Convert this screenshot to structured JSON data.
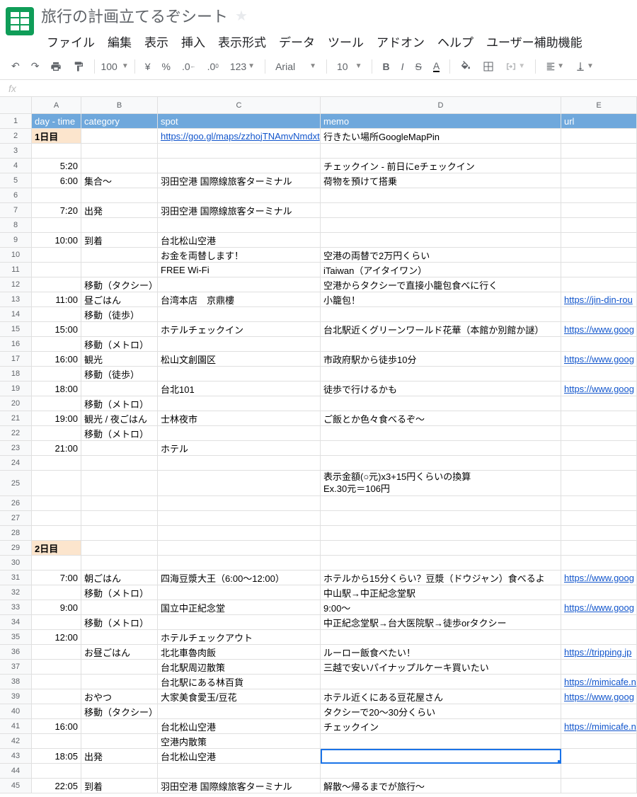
{
  "doc": {
    "title": "旅行の計画立てるぞシート"
  },
  "menu": [
    "ファイル",
    "編集",
    "表示",
    "挿入",
    "表示形式",
    "データ",
    "ツール",
    "アドオン",
    "ヘルプ",
    "ユーザー補助機能"
  ],
  "toolbar": {
    "zoom": "100",
    "currency": "¥",
    "percent": "%",
    "dec_dec": ".0",
    "dec_inc": ".00",
    "numfmt": "123",
    "font": "Arial",
    "size": "10"
  },
  "cols": [
    "A",
    "B",
    "C",
    "D",
    "E"
  ],
  "headers": {
    "A": "day - time",
    "B": "category",
    "C": "spot",
    "D": "memo",
    "E": "url"
  },
  "rows": [
    {
      "n": 1,
      "hdr": true
    },
    {
      "n": 2,
      "A": "1日目",
      "day": true,
      "Clink": "https://goo.gl/maps/zzhojTNAmvNmdxt",
      "D": "行きたい場所GoogleMapPin"
    },
    {
      "n": 3
    },
    {
      "n": 4,
      "A": "5:20",
      "D": "チェックイン - 前日にeチェックイン"
    },
    {
      "n": 5,
      "A": "6:00",
      "B": "集合〜",
      "C": "羽田空港 国際線旅客ターミナル",
      "D": "荷物を預けて搭乗"
    },
    {
      "n": 6
    },
    {
      "n": 7,
      "A": "7:20",
      "B": "出発",
      "C": "羽田空港 国際線旅客ターミナル"
    },
    {
      "n": 8
    },
    {
      "n": 9,
      "A": "10:00",
      "B": "到着",
      "C": "台北松山空港"
    },
    {
      "n": 10,
      "C": "お金を両替します！",
      "D": "空港の両替で2万円くらい"
    },
    {
      "n": 11,
      "C": "FREE Wi-Fi",
      "D": "iTaiwan（アイタイワン）"
    },
    {
      "n": 12,
      "B": "移動（タクシー）",
      "D": "空港からタクシーで直接小籠包食べに行く"
    },
    {
      "n": 13,
      "A": "11:00",
      "B": "昼ごはん",
      "C": "台湾本店　京鼎樓",
      "D": "小籠包！",
      "Elink": "https://jin-din-rou"
    },
    {
      "n": 14,
      "B": "移動（徒歩）"
    },
    {
      "n": 15,
      "A": "15:00",
      "C": "ホテルチェックイン",
      "D": "台北駅近くグリーンワールド花華（本館か別館か謎）",
      "Elink": "https://www.goog"
    },
    {
      "n": 16,
      "B": "移動（メトロ）"
    },
    {
      "n": 17,
      "A": "16:00",
      "B": "観光",
      "C": "松山文創園区",
      "D": "市政府駅から徒歩10分",
      "Elink": "https://www.goog"
    },
    {
      "n": 18,
      "B": "移動（徒歩）"
    },
    {
      "n": 19,
      "A": "18:00",
      "C": "台北101",
      "D": "徒歩で行けるかも",
      "Elink": "https://www.goog"
    },
    {
      "n": 20,
      "B": "移動（メトロ）"
    },
    {
      "n": 21,
      "A": "19:00",
      "B": "観光 / 夜ごはん",
      "C": "士林夜市",
      "D": "ご飯とか色々食べるぞ〜"
    },
    {
      "n": 22,
      "B": "移動（メトロ）"
    },
    {
      "n": 23,
      "A": "21:00",
      "C": "ホテル"
    },
    {
      "n": 24
    },
    {
      "n": 25,
      "tall": true,
      "D": "表示金額(○元)x3+15円くらいの換算\nEx.30元＝106円"
    },
    {
      "n": 26
    },
    {
      "n": 27
    },
    {
      "n": 28
    },
    {
      "n": 29,
      "A": "2日目",
      "day": true
    },
    {
      "n": 30
    },
    {
      "n": 31,
      "A": "7:00",
      "B": "朝ごはん",
      "C": "四海豆漿大王（6:00〜12:00）",
      "D": "ホテルから15分くらい？豆漿（ドウジャン）食べるよ",
      "Elink": "https://www.goog"
    },
    {
      "n": 32,
      "B": "移動（メトロ）",
      "D": "中山駅→中正紀念堂駅"
    },
    {
      "n": 33,
      "A": "9:00",
      "C": "国立中正紀念堂",
      "D": "9:00〜",
      "Elink": "https://www.goog"
    },
    {
      "n": 34,
      "B": "移動（メトロ）",
      "D": "中正紀念堂駅→台大医院駅→徒歩orタクシー"
    },
    {
      "n": 35,
      "A": "12:00",
      "C": "ホテルチェックアウト"
    },
    {
      "n": 36,
      "B": "お昼ごはん",
      "C": "北北車魯肉飯",
      "D": "ルーロー飯食べたい！",
      "Elink": "https://tripping.jp"
    },
    {
      "n": 37,
      "C": "台北駅周辺散策",
      "D": "三越で安いパイナップルケーキ買いたい"
    },
    {
      "n": 38,
      "C": "台北駅にある林百貨",
      "Elink": "https://mimicafe.n"
    },
    {
      "n": 39,
      "B": "おやつ",
      "C": "大家美食愛玉/豆花",
      "D": "ホテル近くにある豆花屋さん",
      "Elink": "https://www.goog"
    },
    {
      "n": 40,
      "B": "移動（タクシー）",
      "D": "タクシーで20〜30分くらい"
    },
    {
      "n": 41,
      "A": "16:00",
      "C": "台北松山空港",
      "D": "チェックイン",
      "Elink": "https://mimicafe.n"
    },
    {
      "n": 42,
      "C": "空港内散策"
    },
    {
      "n": 43,
      "A": "18:05",
      "B": "出発",
      "C": "台北松山空港",
      "sel": "D"
    },
    {
      "n": 44
    },
    {
      "n": 45,
      "A": "22:05",
      "B": "到着",
      "C": "羽田空港 国際線旅客ターミナル",
      "D": "解散〜帰るまでが旅行〜"
    }
  ]
}
